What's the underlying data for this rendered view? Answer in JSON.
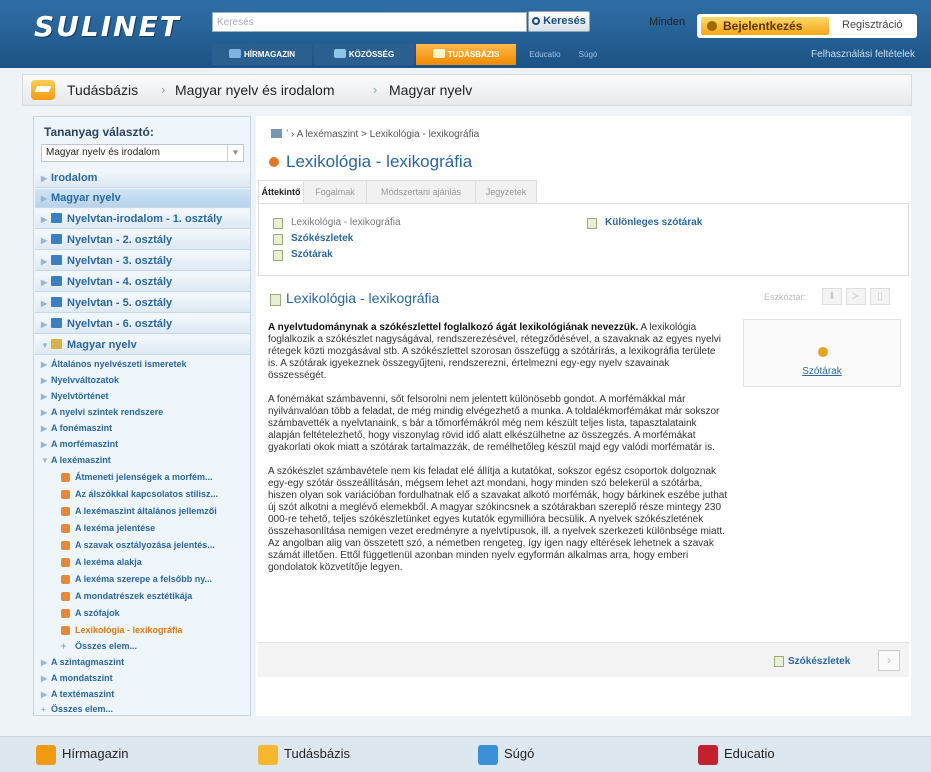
{
  "header": {
    "logo": "SULINET",
    "search": {
      "placeholder": "Keresés",
      "scope": "Minden",
      "button": "Keresés"
    },
    "login": "Bejelentkezés",
    "register": "Regisztráció",
    "nav": [
      "HÍRMAGAZIN",
      "KÖZÖSSÉG",
      "TUDÁSBÁZIS",
      "Educatio",
      "Súgó"
    ],
    "terms": "Felhasználási feltételek"
  },
  "breadcrumb": [
    "Tudásbázis",
    "Magyar nyelv és irodalom",
    "Magyar nyelv"
  ],
  "sidebar": {
    "title": "Tananyag választó:",
    "select": "Magyar nyelv és irodalom",
    "big_items": [
      "Irodalom",
      "Magyar nyelv",
      "Nyelvtan-irodalom - 1. osztály",
      "Nyelvtan - 2. osztály",
      "Nyelvtan - 3. osztály",
      "Nyelvtan - 4. osztály",
      "Nyelvtan - 5. osztály",
      "Nyelvtan - 6. osztály",
      "Magyar nyelv"
    ],
    "small_items": [
      "Általános nyelvészeti ismeretek",
      "Nyelvváltozatok",
      "Nyelvtörténet",
      "A nyelvi szintek rendszere",
      "A fonémaszint",
      "A morfémaszint",
      "A lexémaszint"
    ],
    "leaves": [
      "Átmeneti jelenségek a morfém...",
      "Az álszókkal kapcsolatos stilisz...",
      "A lexémaszint általános jellemzői",
      "A lexéma jelentése",
      "A szavak osztályozása jelentés...",
      "A lexéma alakja",
      "A lexéma szerepe a felsőbb ny...",
      "A mondatrészek esztétikája",
      "A szófajok",
      "Lexikológia - lexikográfia"
    ],
    "leaf_more": "Összes elem...",
    "bottom_items": [
      "A szintagmaszint",
      "A mondatszint",
      "A textémaszint"
    ],
    "bottom_more": "Összes elem..."
  },
  "content": {
    "crumb": "A lexémaszint > Lexikológia - lexikográfia",
    "title": "Lexikológia - lexikográfia",
    "tabs": [
      "Áttekintő",
      "Fogalmak",
      "Módszertani ajánlás",
      "Jegyzetek"
    ],
    "links": [
      "Lexikológia - lexikográfia",
      "Szókészletek",
      "Szótárak",
      "Különleges szótárak"
    ],
    "section_title": "Lexikológia - lexikográfia",
    "toolbar_label": "Eszköztár:",
    "paragraphs": [
      {
        "b": "A nyelvtudománynak a szókészlettel foglalkozó ágát lexikológiának nevezzük.",
        "t": "A lexikológia foglalkozik a szókészlet nagyságával, rendszerezésével, rétegződésével, a szavaknak az egyes nyelvi rétegek közti mozgásával stb. A szókészlettel szorosan összefügg a szótárírás, a lexikográfia területe is. A szótárak igyekeznek összegyűjteni, rendszerezni, értelmezni egy-egy nyelv szavainak összességét."
      },
      {
        "b": "",
        "t": "A fonémákat számbavenni, sőt felsorolni nem jelentett különösebb gondot. A morfémákkal már nyilvánvalóan több a feladat, de még mindig elvégezhető a munka. A toldalékmorfémákat már sokszor számbavették a nyelvtanaink, s bár a tőmorfémákról még nem készült teljes lista, tapasztalataink alapján feltételezhető, hogy viszonylag rövid idő alatt elkészülhetne az összegzés. A morfémákat gyakorlati okok miatt a szótárak tartalmazzák, de remélhetőleg készül majd egy valódi morfématár is."
      },
      {
        "b": "",
        "t": "A szókészlet számbavétele nem kis feladat elé állítja a kutatókat, sokszor egész csoportok dolgoznak egy-egy szótár összeállításán, mégsem lehet azt mondani, hogy minden szó belekerül a szótárba, hiszen olyan sok variációban fordulhatnak elő a szavakat alkotó morfémák, hogy bárkinek eszébe juthat új szót alkotni a meglévő elemekből. A magyar szókincsnek a szótárakban szereplő része mintegy 230 000-re tehető, teljes szókészletünket egyes kutatók egymillióra becsülik. A nyelvek szókészletének összehasonlítása nemigen vezet eredményre a nyelvtípusok, ill. a nyelvek szerkezeti különbsége miatt. Az angolban alig van összetett szó, a németben rengeteg, így igen nagy eltérések lehetnek a szavak számát illetően. Ettől függetlenül azonban minden nyelv egyformán alkalmas arra, hogy emberi gondolatok közvetítője legyen."
      }
    ],
    "sidebox_link": "Szótárak",
    "next_label": "Szókészletek"
  },
  "footer": [
    "Hírmagazin",
    "Tudásbázis",
    "Súgó",
    "Educatio"
  ],
  "colors": {
    "brand_blue": "#1d5386",
    "accent_orange": "#f08a00",
    "link": "#2a67a0"
  }
}
